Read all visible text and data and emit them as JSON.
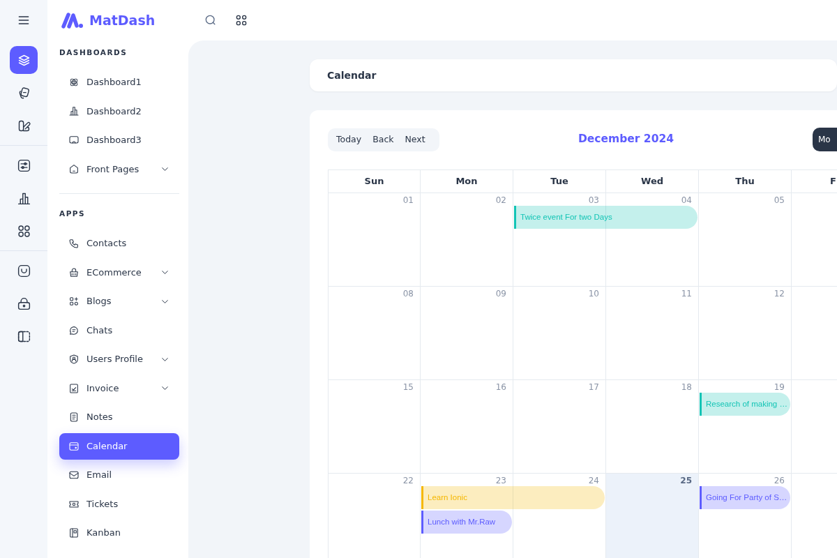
{
  "topbar": {
    "brand": "MatDash"
  },
  "rail": {
    "groups": [
      {
        "items": [
          {
            "selected": true
          },
          {
            "selected": false
          },
          {
            "selected": false
          }
        ]
      },
      {
        "items": [
          {
            "selected": false
          },
          {
            "selected": false
          },
          {
            "selected": false
          }
        ]
      },
      {
        "items": [
          {
            "selected": false
          },
          {
            "selected": false
          },
          {
            "selected": false
          }
        ]
      }
    ]
  },
  "sidebar": {
    "sections": [
      {
        "heading": "DASHBOARDS",
        "items": [
          {
            "label": "Dashboard1",
            "expandable": false,
            "selected": false
          },
          {
            "label": "Dashboard2",
            "expandable": false,
            "selected": false
          },
          {
            "label": "Dashboard3",
            "expandable": false,
            "selected": false
          },
          {
            "label": "Front Pages",
            "expandable": true,
            "selected": false
          }
        ]
      },
      {
        "heading": "APPS",
        "items": [
          {
            "label": "Contacts",
            "expandable": false,
            "selected": false
          },
          {
            "label": "ECommerce",
            "expandable": true,
            "selected": false
          },
          {
            "label": "Blogs",
            "expandable": true,
            "selected": false
          },
          {
            "label": "Chats",
            "expandable": false,
            "selected": false
          },
          {
            "label": "Users Profile",
            "expandable": true,
            "selected": false
          },
          {
            "label": "Invoice",
            "expandable": true,
            "selected": false
          },
          {
            "label": "Notes",
            "expandable": false,
            "selected": false
          },
          {
            "label": "Calendar",
            "expandable": false,
            "selected": true
          },
          {
            "label": "Email",
            "expandable": false,
            "selected": false
          },
          {
            "label": "Tickets",
            "expandable": false,
            "selected": false
          },
          {
            "label": "Kanban",
            "expandable": false,
            "selected": false
          }
        ]
      }
    ]
  },
  "breadcrumb": {
    "title": "Calendar"
  },
  "calendar": {
    "nav_buttons": [
      "Today",
      "Back",
      "Next"
    ],
    "title": "December 2024",
    "view_button": "Mo",
    "weekdays": [
      "Sun",
      "Mon",
      "Tue",
      "Wed",
      "Thu",
      "F"
    ],
    "weeks": [
      {
        "days": [
          {
            "date": "01",
            "today": false
          },
          {
            "date": "02",
            "today": false
          },
          {
            "date": "03",
            "today": false,
            "events": [
              {
                "title": "Twice event For two Days",
                "multi_day": true,
                "color": "#13c4b5"
              }
            ]
          },
          {
            "date": "04",
            "today": false
          },
          {
            "date": "05",
            "today": false
          }
        ]
      },
      {
        "days": [
          {
            "date": "08",
            "today": false
          },
          {
            "date": "09",
            "today": false
          },
          {
            "date": "10",
            "today": false
          },
          {
            "date": "11",
            "today": false
          },
          {
            "date": "12",
            "today": false
          }
        ]
      },
      {
        "days": [
          {
            "date": "15",
            "today": false
          },
          {
            "date": "16",
            "today": false
          },
          {
            "date": "17",
            "today": false
          },
          {
            "date": "18",
            "today": false
          },
          {
            "date": "19",
            "today": false,
            "events": [
              {
                "title": "Research of making …",
                "multi_day": false,
                "color": "#13c4b5"
              }
            ]
          }
        ]
      },
      {
        "days": [
          {
            "date": "22",
            "today": false
          },
          {
            "date": "23",
            "today": false,
            "events": [
              {
                "title": "Learn Ionic",
                "multi_day": true,
                "color": "#f5b700"
              },
              {
                "title": "Lunch with Mr.Raw",
                "multi_day": false,
                "color": "#5d5cff"
              }
            ]
          },
          {
            "date": "24",
            "today": false
          },
          {
            "date": "25",
            "today": true
          },
          {
            "date": "26",
            "today": false,
            "events": [
              {
                "title": "Going For Party of S…",
                "multi_day": false,
                "color": "#5d5cff"
              }
            ]
          }
        ]
      }
    ]
  }
}
